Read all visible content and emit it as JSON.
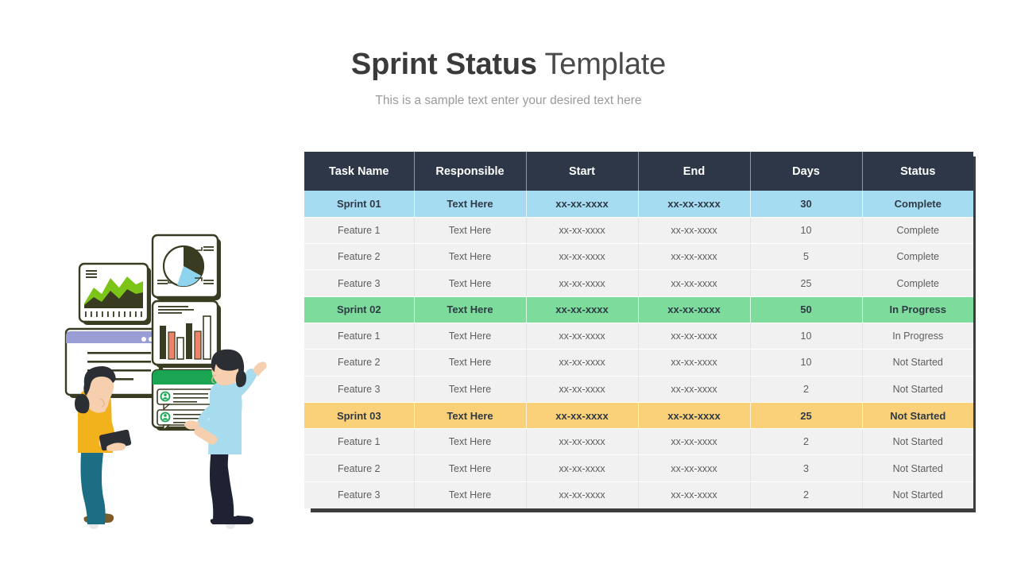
{
  "header": {
    "title_bold": "Sprint Status",
    "title_light": "Template",
    "subtitle": "This is a sample text enter your desired text here"
  },
  "table": {
    "columns": [
      "Task Name",
      "Responsible",
      "Start",
      "End",
      "Days",
      "Status"
    ],
    "rows": [
      {
        "kind": "sprint",
        "tone": "blue",
        "task": "Sprint 01",
        "responsible": "Text Here",
        "start": "xx-xx-xxxx",
        "end": "xx-xx-xxxx",
        "days": "30",
        "status": "Complete"
      },
      {
        "kind": "feature",
        "tone": "plain",
        "task": "Feature 1",
        "responsible": "Text Here",
        "start": "xx-xx-xxxx",
        "end": "xx-xx-xxxx",
        "days": "10",
        "status": "Complete"
      },
      {
        "kind": "feature",
        "tone": "plain",
        "task": "Feature 2",
        "responsible": "Text Here",
        "start": "xx-xx-xxxx",
        "end": "xx-xx-xxxx",
        "days": "5",
        "status": "Complete"
      },
      {
        "kind": "feature",
        "tone": "plain",
        "task": "Feature 3",
        "responsible": "Text Here",
        "start": "xx-xx-xxxx",
        "end": "xx-xx-xxxx",
        "days": "25",
        "status": "Complete"
      },
      {
        "kind": "sprint",
        "tone": "green",
        "task": "Sprint 02",
        "responsible": "Text Here",
        "start": "xx-xx-xxxx",
        "end": "xx-xx-xxxx",
        "days": "50",
        "status": "In Progress"
      },
      {
        "kind": "feature",
        "tone": "plain",
        "task": "Feature 1",
        "responsible": "Text Here",
        "start": "xx-xx-xxxx",
        "end": "xx-xx-xxxx",
        "days": "10",
        "status": "In Progress"
      },
      {
        "kind": "feature",
        "tone": "plain",
        "task": "Feature 2",
        "responsible": "Text Here",
        "start": "xx-xx-xxxx",
        "end": "xx-xx-xxxx",
        "days": "10",
        "status": "Not Started"
      },
      {
        "kind": "feature",
        "tone": "plain",
        "task": "Feature 3",
        "responsible": "Text Here",
        "start": "xx-xx-xxxx",
        "end": "xx-xx-xxxx",
        "days": "2",
        "status": "Not Started"
      },
      {
        "kind": "sprint",
        "tone": "yellow",
        "task": "Sprint 03",
        "responsible": "Text Here",
        "start": "xx-xx-xxxx",
        "end": "xx-xx-xxxx",
        "days": "25",
        "status": "Not Started"
      },
      {
        "kind": "feature",
        "tone": "plain",
        "task": "Feature 1",
        "responsible": "Text Here",
        "start": "xx-xx-xxxx",
        "end": "xx-xx-xxxx",
        "days": "2",
        "status": "Not Started"
      },
      {
        "kind": "feature",
        "tone": "plain",
        "task": "Feature 2",
        "responsible": "Text Here",
        "start": "xx-xx-xxxx",
        "end": "xx-xx-xxxx",
        "days": "3",
        "status": "Not Started"
      },
      {
        "kind": "feature",
        "tone": "plain",
        "task": "Feature 3",
        "responsible": "Text Here",
        "start": "xx-xx-xxxx",
        "end": "xx-xx-xxxx",
        "days": "2",
        "status": "Not Started"
      }
    ]
  },
  "colors": {
    "header_navy": "#2d3748",
    "row_blue": "#a5dcf2",
    "row_green": "#7ddb9b",
    "row_yellow": "#fad179",
    "row_plain": "#f1f1f1",
    "shadow": "#3d3d3d",
    "title_text": "#3f3f3f",
    "subtitle_text": "#9a9a9a"
  },
  "illustration": {
    "alt": "two people reviewing dashboard cards",
    "cards": [
      "area-chart-card",
      "pie-chart-card",
      "bar-chart-card",
      "comments-card",
      "browser-window-card"
    ],
    "people": [
      "woman-with-tablet",
      "man-pointing"
    ]
  }
}
